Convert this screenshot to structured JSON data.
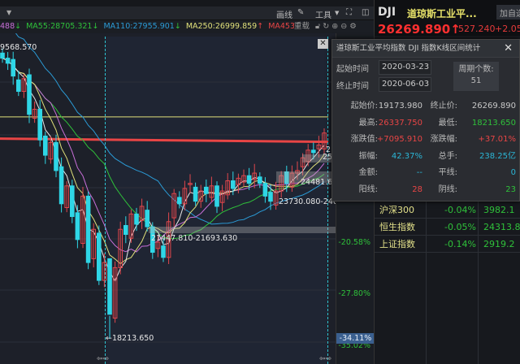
{
  "toolbar": {
    "draw_label": "画线",
    "tools_label": "工具",
    "reload_label": "重载"
  },
  "ma": [
    {
      "label": "488",
      "dir": "↓",
      "color": "#c86fd8"
    },
    {
      "label": "MA55:28705.321",
      "dir": "↓",
      "color": "#2fc13a"
    },
    {
      "label": "MA110:27955.901",
      "dir": "↓",
      "color": "#2b9bd6"
    },
    {
      "label": "MA250:26999.859",
      "dir": "↑",
      "color": "#e0e07a"
    },
    {
      "label": "MA453:2(",
      "dir": "",
      "color": "#e84545"
    }
  ],
  "quote": {
    "symbol": "DJI",
    "name": "道琼斯工业平...",
    "add_label": "加自选",
    "price": "26269.890",
    "price_arrow": "↑",
    "change": "527.240",
    "change_pct": "+2.05%"
  },
  "dialog": {
    "title": "道琼斯工业平均指数  DJI  指数K线区间统计",
    "start_label": "起始时间",
    "start_value": "2020-03-23",
    "end_label": "终止时间",
    "end_value": "2020-06-03",
    "period_label": "周期个数:",
    "period_value": "51",
    "stats": [
      {
        "l1": "起始价:",
        "v1": "19173.980",
        "c1": "white",
        "l2": "终止价:",
        "v2": "26269.890",
        "c2": "white"
      },
      {
        "l1": "最高:",
        "v1": "26337.750",
        "c1": "red",
        "l2": "最低:",
        "v2": "18213.650",
        "c2": "green"
      },
      {
        "l1": "涨跌值:",
        "v1": "+7095.910",
        "c1": "red",
        "l2": "涨跌幅:",
        "v2": "+37.01%",
        "c2": "red"
      },
      {
        "l1": "振幅:",
        "v1": "42.37%",
        "c1": "cyan",
        "l2": "总手:",
        "v2": "238.25亿",
        "c2": "cyan"
      },
      {
        "l1": "金额:",
        "v1": "--",
        "c1": "cyan",
        "l2": "平线:",
        "v2": "0",
        "c2": "cyan"
      },
      {
        "l1": "阳线:",
        "v1": "28",
        "c1": "red",
        "l2": "阴线:",
        "v2": "23",
        "c2": "green"
      }
    ]
  },
  "indices": [
    {
      "name": "沪深300",
      "pct": "-0.04%",
      "value": "3982.1"
    },
    {
      "name": "恒生指数",
      "pct": "-0.05%",
      "value": "24313.89"
    },
    {
      "name": "上证指数",
      "pct": "-0.14%",
      "value": "2919.2"
    }
  ],
  "axis": {
    "labels": [
      "-20.58%",
      "-27.80%",
      "-35.02%"
    ],
    "current": "-34.11%"
  },
  "chart_labels": {
    "high": "9568.570",
    "low": "←18213.650",
    "band1": "21447.810-21693.630",
    "band2": "23730.080-240",
    "band3": "24481.64",
    "right1": "2",
    "right2": "25"
  },
  "chart_data": {
    "type": "candlestick",
    "price_range": [
      18213.65,
      29568.57
    ],
    "closes": [
      29200,
      29000,
      28500,
      27900,
      28400,
      27000,
      27200,
      26000,
      25400,
      25900,
      24800,
      23500,
      24200,
      23000,
      22100,
      23800,
      21200,
      22500,
      20500,
      21200,
      19173,
      21000,
      22500,
      22300,
      23100,
      22700,
      23400,
      22600,
      21600,
      22000,
      21400,
      22800,
      23900,
      23500,
      24100,
      24300,
      23600,
      24000,
      23900,
      24200,
      23400,
      24000,
      24400,
      24100,
      24500,
      24600,
      24300,
      24700,
      24300,
      23800,
      23600,
      24000,
      24600,
      24300,
      24700,
      24800,
      25300,
      25600,
      25500,
      25800,
      26270
    ],
    "ma_flat": [
      {
        "name": "MA453",
        "value": 26050,
        "color": "#e84545"
      },
      {
        "name": "MA250",
        "value": 26900,
        "color": "#e0e07a"
      }
    ]
  }
}
